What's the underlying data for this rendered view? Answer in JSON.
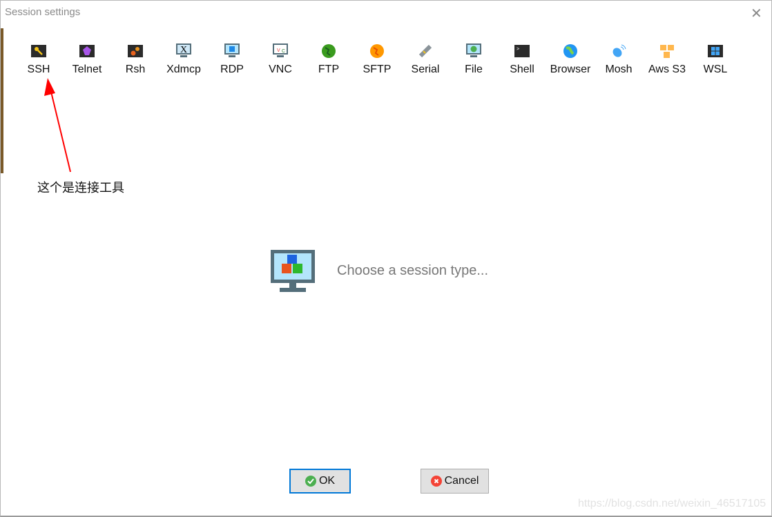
{
  "dialog": {
    "title": "Session settings",
    "close_icon": "close-icon"
  },
  "session_types": [
    {
      "label": "SSH",
      "icon": "key-icon"
    },
    {
      "label": "Telnet",
      "icon": "purple-gem-icon"
    },
    {
      "label": "Rsh",
      "icon": "gears-icon"
    },
    {
      "label": "Xdmcp",
      "icon": "x-monitor-icon"
    },
    {
      "label": "RDP",
      "icon": "windows-monitor-icon"
    },
    {
      "label": "VNC",
      "icon": "vnc-monitor-icon"
    },
    {
      "label": "FTP",
      "icon": "green-globe-icon"
    },
    {
      "label": "SFTP",
      "icon": "orange-globe-icon"
    },
    {
      "label": "Serial",
      "icon": "plug-icon"
    },
    {
      "label": "File",
      "icon": "globe-monitor-icon"
    },
    {
      "label": "Shell",
      "icon": "terminal-icon"
    },
    {
      "label": "Browser",
      "icon": "earth-icon"
    },
    {
      "label": "Mosh",
      "icon": "satellite-dish-icon"
    },
    {
      "label": "Aws S3",
      "icon": "cubes-icon"
    },
    {
      "label": "WSL",
      "icon": "windows-logo-icon"
    }
  ],
  "annotation": {
    "text": "这个是连接工具",
    "color": "#ff0000"
  },
  "main": {
    "placeholder": "Choose a session type..."
  },
  "buttons": {
    "ok": "OK",
    "cancel": "Cancel"
  },
  "watermark": "https://blog.csdn.net/weixin_46517105",
  "colors": {
    "accent": "#0078d7",
    "ok_green": "#4caf50",
    "cancel_red": "#f44336"
  }
}
